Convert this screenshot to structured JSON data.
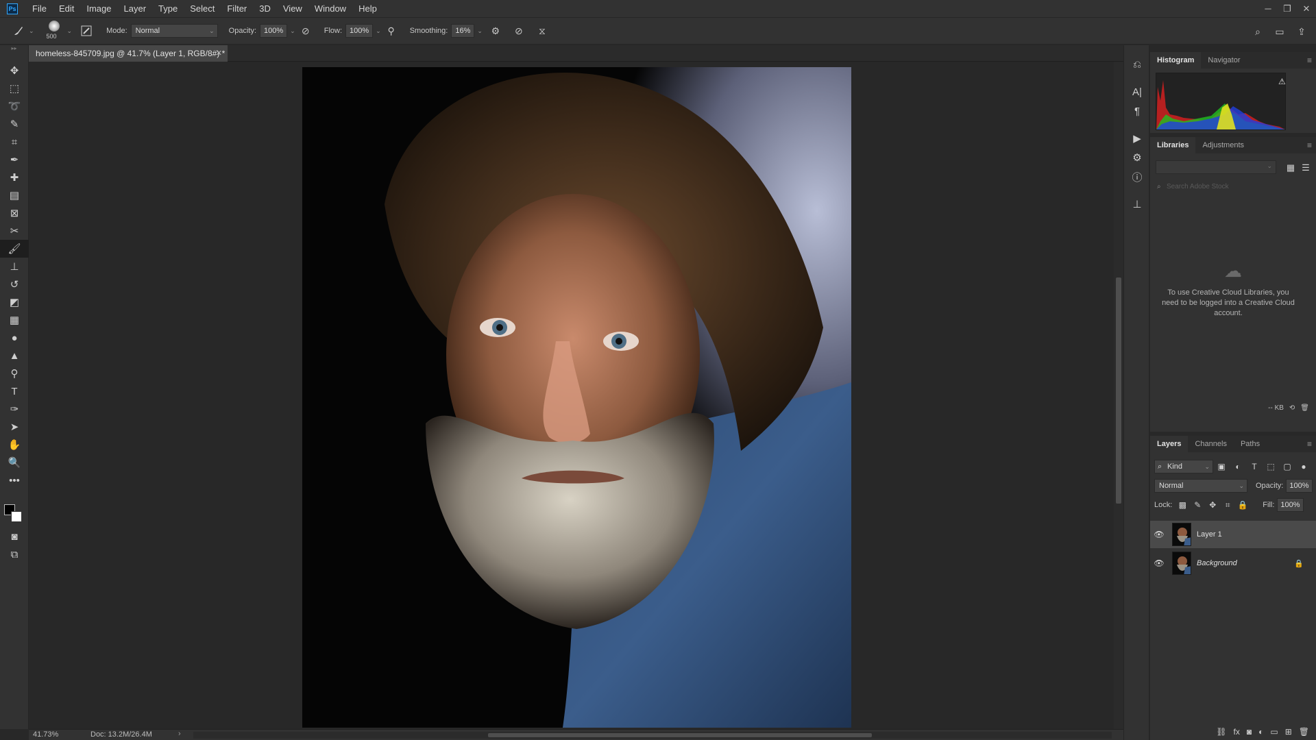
{
  "menubar": {
    "logo": "Ps",
    "items": [
      "File",
      "Edit",
      "Image",
      "Layer",
      "Type",
      "Select",
      "Filter",
      "3D",
      "View",
      "Window",
      "Help"
    ]
  },
  "options": {
    "brush_size": "500",
    "mode_label": "Mode:",
    "mode_value": "Normal",
    "opacity_label": "Opacity:",
    "opacity_value": "100%",
    "flow_label": "Flow:",
    "flow_value": "100%",
    "smoothing_label": "Smoothing:",
    "smoothing_value": "16%"
  },
  "document": {
    "tab_title": "homeless-845709.jpg @ 41.7% (Layer 1, RGB/8#) *",
    "zoom": "41.73%",
    "doc_size": "Doc: 13.2M/26.4M"
  },
  "histogram_panel": {
    "tabs": [
      "Histogram",
      "Navigator"
    ]
  },
  "libraries_panel": {
    "tabs": [
      "Libraries",
      "Adjustments"
    ],
    "search_placeholder": "Search Adobe Stock",
    "message": "To use Creative Cloud Libraries, you need to be logged into a Creative Cloud account.",
    "size": "-- KB"
  },
  "layers_panel": {
    "tabs": [
      "Layers",
      "Channels",
      "Paths"
    ],
    "kind": "Kind",
    "blend_mode": "Normal",
    "opacity_label": "Opacity:",
    "opacity_value": "100%",
    "lock_label": "Lock:",
    "fill_label": "Fill:",
    "fill_value": "100%",
    "layers": [
      {
        "name": "Layer 1"
      },
      {
        "name": "Background"
      }
    ]
  }
}
